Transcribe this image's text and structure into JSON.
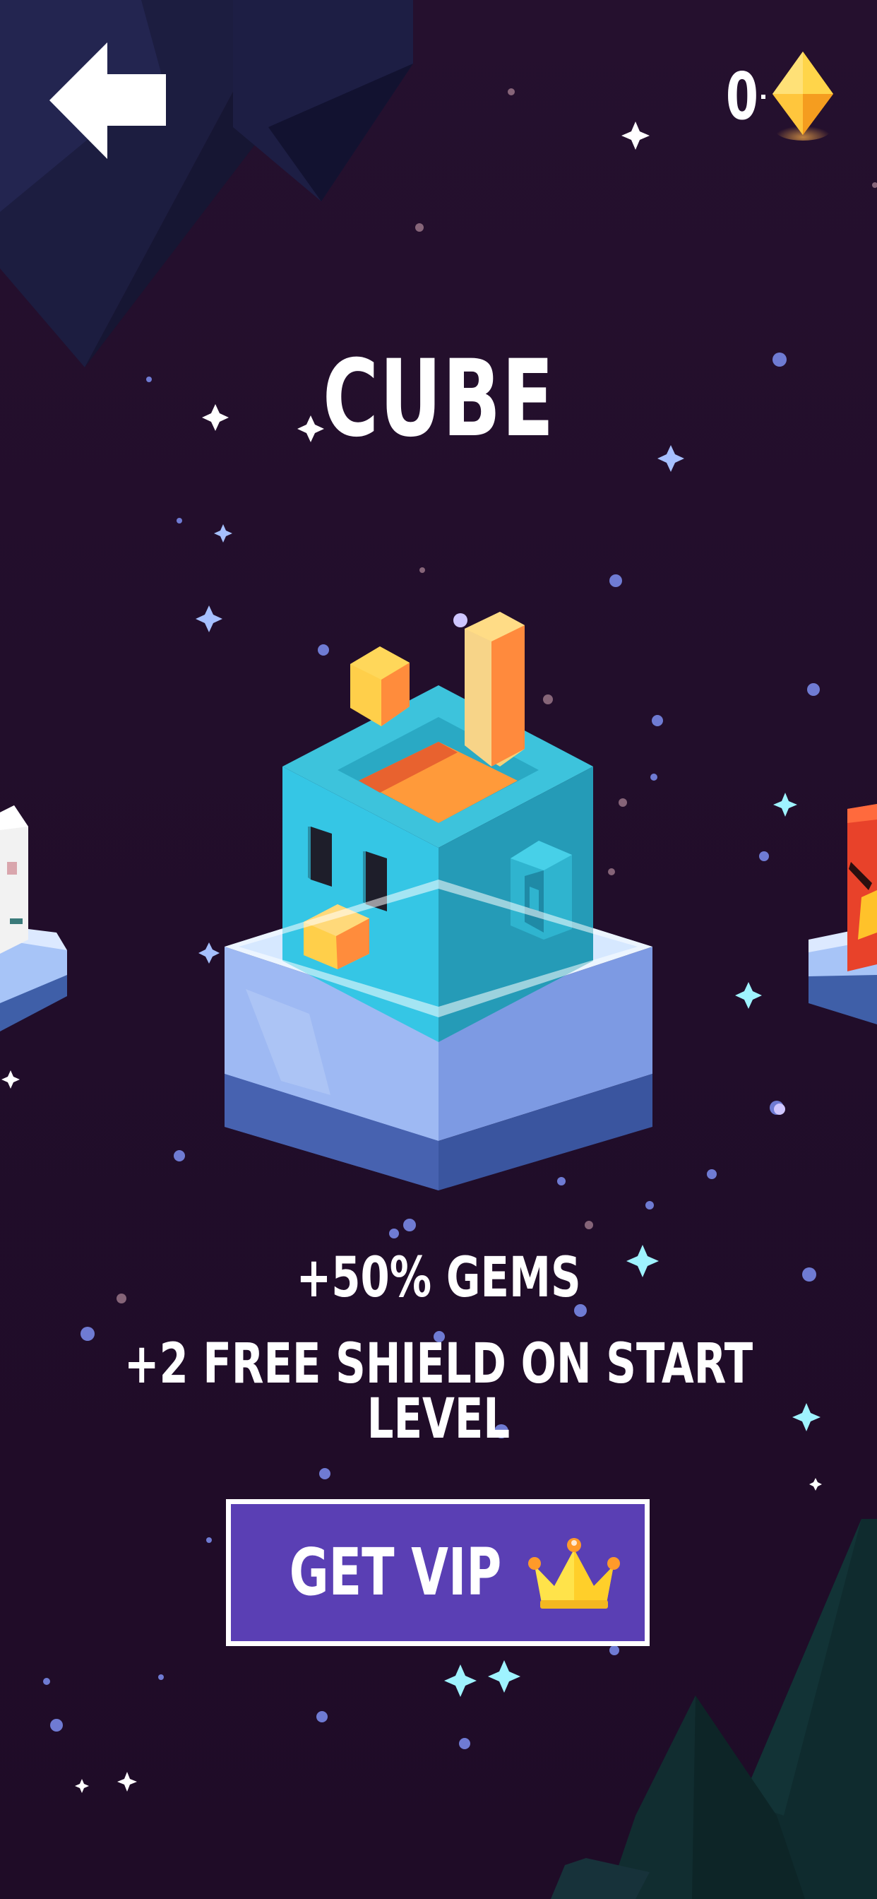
{
  "header": {
    "back_icon": "arrow-left-icon",
    "gem_count": "0",
    "gem_icon": "diamond-gem-icon"
  },
  "skin": {
    "title": "CUBE",
    "perks": [
      "+50% GEMS",
      "+2 FREE SHIELD ON START LEVEL"
    ]
  },
  "vip_button": {
    "label": "GET VIP",
    "icon": "crown-icon"
  },
  "colors": {
    "background": "#230f2c",
    "button_fill": "#5a3fb4",
    "button_border": "#ffffff",
    "gem_yellow": "#ffc83d",
    "cube_teal": "#3cc7e0",
    "platform_blue": "#8fb4f2"
  }
}
